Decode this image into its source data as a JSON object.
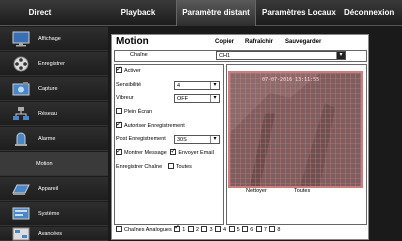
{
  "topnav": {
    "tabs": [
      {
        "label": "Direct"
      },
      {
        "label": "Playback"
      },
      {
        "label": "Paramètre distant"
      },
      {
        "label": "Paramètres Locaux"
      },
      {
        "label": "Déconnexion"
      }
    ]
  },
  "sidebar": {
    "items": [
      {
        "label": "Affichage",
        "icon": "monitor-icon"
      },
      {
        "label": "Enregistrer",
        "icon": "film-reel-icon"
      },
      {
        "label": "Capture",
        "icon": "camera-icon"
      },
      {
        "label": "Réseau",
        "icon": "network-icon"
      },
      {
        "label": "Alarme",
        "icon": "alarm-icon"
      },
      {
        "label": "Motion",
        "icon": ""
      },
      {
        "label": "Appareil",
        "icon": "hdd-icon"
      },
      {
        "label": "Système",
        "icon": "system-icon"
      },
      {
        "label": "Avancées",
        "icon": "advanced-icon"
      }
    ]
  },
  "panel": {
    "title": "Motion",
    "copy_label": "Copier",
    "refresh_label": "Rafraîchir",
    "save_label": "Sauvegarder",
    "channel_label": "Chaîne",
    "channel_value": "CH1",
    "activate_label": "Activer",
    "activate_checked": true,
    "sensitivity_label": "Sensibilité",
    "sensitivity_value": "4",
    "buzzer_label": "Vibreur",
    "buzzer_value": "OFF",
    "fullscreen_label": "Plein Écran",
    "fullscreen_checked": false,
    "allow_record_label": "Autoriser Enregistrement",
    "allow_record_checked": true,
    "post_record_label": "Post Enregistrement",
    "post_record_value": "30S",
    "show_message_label": "Montrer Message",
    "show_message_checked": true,
    "send_email_label": "Envoyer Email",
    "send_email_checked": true,
    "record_channel_label": "Enregistrer Chaîne",
    "all_label": "Toutes",
    "video_timestamp": "07-07-2016 13:11:55",
    "clear_label": "Nettoyer",
    "all_video_label": "Toutes",
    "analog_channels_label": "Chaînes Analogues",
    "analog_channels": [
      "1",
      "2",
      "3",
      "4",
      "5",
      "6",
      "7",
      "8"
    ]
  },
  "colors": {
    "accent_grid": "#cc7d7d",
    "panel_bg": "#ffffff",
    "nav_bg": "#1c1c1c"
  }
}
